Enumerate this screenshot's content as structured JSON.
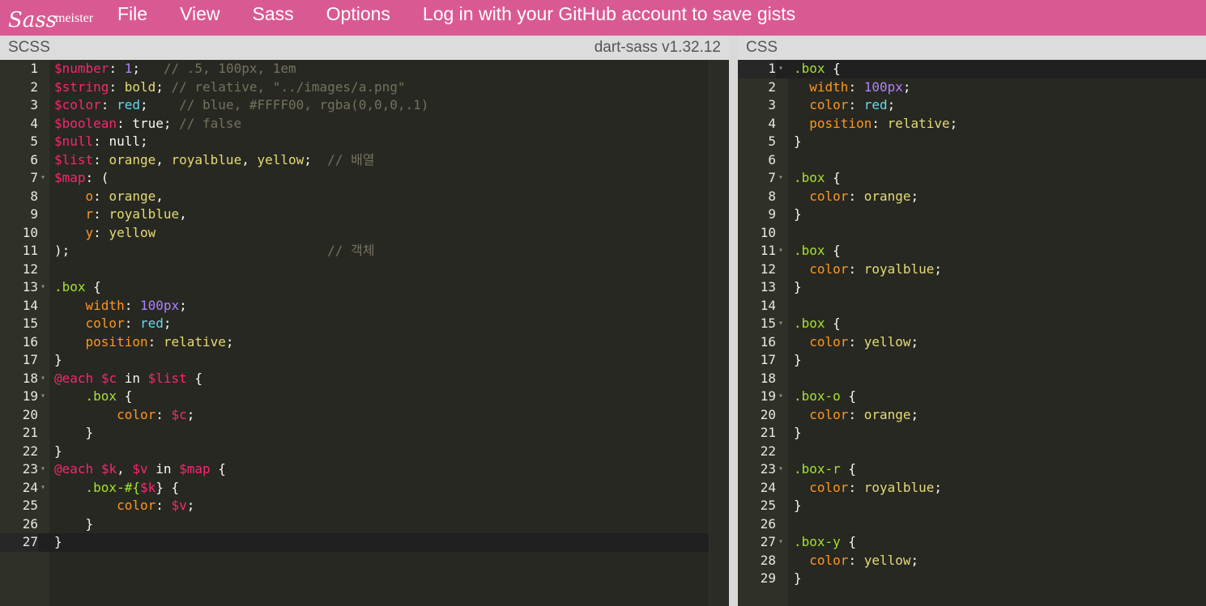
{
  "topbar": {
    "logo_sass": "Sass",
    "logo_meister": "meister",
    "menu": [
      "File",
      "View",
      "Sass",
      "Options",
      "Log in with your GitHub account to save gists"
    ]
  },
  "left_pane": {
    "title": "SCSS",
    "version": "dart-sass v1.32.12",
    "lines": [
      "$number: 1;   // .5, 100px, 1em",
      "$string: bold; // relative, \"../images/a.png\"",
      "$color: red;    // blue, #FFFF00, rgba(0,0,0,.1)",
      "$boolean: true; // false",
      "$null: null;",
      "$list: orange, royalblue, yellow;  // 배열",
      "$map: (",
      "    o: orange,",
      "    r: royalblue,",
      "    y: yellow",
      ");                                 // 객체",
      "",
      ".box {",
      "    width: 100px;",
      "    color: red;",
      "    position: relative;",
      "}",
      "@each $c in $list {",
      "    .box {",
      "        color: $c;",
      "    }",
      "}",
      "@each $k, $v in $map {",
      "    .box-#{$k} {",
      "        color: $v;",
      "    }",
      "}"
    ],
    "fold_lines": [
      7,
      13,
      18,
      19,
      23,
      24
    ],
    "active_line": 27
  },
  "right_pane": {
    "title": "CSS",
    "lines": [
      ".box {",
      "  width: 100px;",
      "  color: red;",
      "  position: relative;",
      "}",
      "",
      ".box {",
      "  color: orange;",
      "}",
      "",
      ".box {",
      "  color: royalblue;",
      "}",
      "",
      ".box {",
      "  color: yellow;",
      "}",
      "",
      ".box-o {",
      "  color: orange;",
      "}",
      "",
      ".box-r {",
      "  color: royalblue;",
      "}",
      "",
      ".box-y {",
      "  color: yellow;",
      "}"
    ],
    "fold_lines": [
      1,
      7,
      11,
      15,
      19,
      23,
      27
    ],
    "active_line": 1
  },
  "colors": {
    "topbar": "#d95a93",
    "editor_bg": "#272822",
    "gutter_bg": "#2f3129"
  }
}
